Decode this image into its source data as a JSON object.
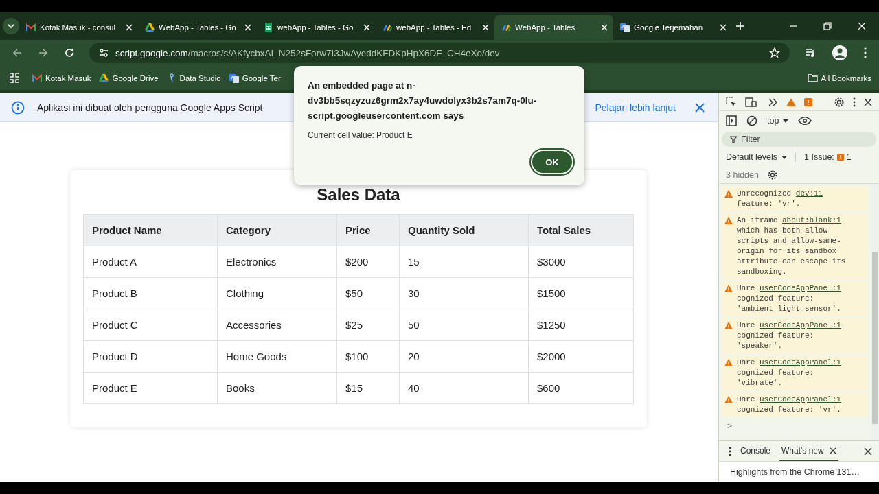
{
  "browser": {
    "tabs": [
      {
        "title": "Kotak Masuk - consul",
        "kind": "mail",
        "selected": false
      },
      {
        "title": "WebApp - Tables - Go",
        "kind": "drive",
        "selected": false
      },
      {
        "title": "webApp - Tables - Go",
        "kind": "sheets",
        "selected": false
      },
      {
        "title": "webApp - Tables - Ed",
        "kind": "script",
        "selected": false
      },
      {
        "title": "WebApp - Tables",
        "kind": "script",
        "selected": true
      },
      {
        "title": "Google Terjemahan",
        "kind": "translate",
        "selected": false
      }
    ],
    "address": {
      "host": "script.google.com",
      "path": "/macros/s/AKfycbxAI_N252sForw7I3JwAyeddKFDKpHpX6DF_CH4eXo/dev"
    },
    "bookmarks": [
      {
        "label": "Kotak Masuk",
        "kind": "mail"
      },
      {
        "label": "Google Drive",
        "kind": "drive"
      },
      {
        "label": "Data Studio",
        "kind": "studio"
      },
      {
        "label": "Google Ter",
        "kind": "translate"
      }
    ],
    "all_bookmarks": "All Bookmarks"
  },
  "infobar": {
    "text": "Aplikasi ini dibuat oleh pengguna Google Apps Script",
    "link": "Pelajari lebih lanjut"
  },
  "card": {
    "title": "Sales Data",
    "table": {
      "columns": [
        "Product Name",
        "Category",
        "Price",
        "Quantity Sold",
        "Total Sales"
      ],
      "rows": [
        [
          "Product A",
          "Electronics",
          "$200",
          "15",
          "$3000"
        ],
        [
          "Product B",
          "Clothing",
          "$50",
          "30",
          "$1500"
        ],
        [
          "Product C",
          "Accessories",
          "$25",
          "50",
          "$1250"
        ],
        [
          "Product D",
          "Home Goods",
          "$100",
          "20",
          "$2000"
        ],
        [
          "Product E",
          "Books",
          "$15",
          "40",
          "$600"
        ]
      ]
    }
  },
  "dialog": {
    "title": "An embedded page at n-dv3bb5sqzyzuz6grm2x7ay4uwdolyx3b2s7am7q-0lu-script.googleusercontent.com says",
    "message": "Current cell value: Product E",
    "button": "OK"
  },
  "devtools": {
    "context": "top",
    "filter_placeholder": "Filter",
    "levels": "Default levels",
    "issues_label": "1 Issue:",
    "issues_count": "1",
    "hidden": "3 hidden",
    "messages": [
      {
        "before": "Unrecognized",
        "link": "dev:11",
        "after": "feature: 'vr'."
      },
      {
        "before": "An iframe",
        "link": "about:blank:1",
        "after": "which has both allow-scripts and allow-same-origin for its sandbox attribute can escape its sandboxing."
      },
      {
        "before": "Unre",
        "link": "userCodeAppPanel:1",
        "after": "cognized feature: 'ambient-light-sensor'."
      },
      {
        "before": "Unre",
        "link": "userCodeAppPanel:1",
        "after": "cognized feature: 'speaker'."
      },
      {
        "before": "Unre",
        "link": "userCodeAppPanel:1",
        "after": "cognized feature: 'vibrate'."
      },
      {
        "before": "Unre",
        "link": "userCodeAppPanel:1",
        "after": "cognized feature: 'vr'."
      }
    ],
    "prompt": ">",
    "drawer_tabs": [
      {
        "label": "Console",
        "selected": false,
        "closable": false
      },
      {
        "label": "What's new",
        "selected": true,
        "closable": true
      }
    ],
    "drawer_text": "Highlights from the Chrome 131…"
  }
}
